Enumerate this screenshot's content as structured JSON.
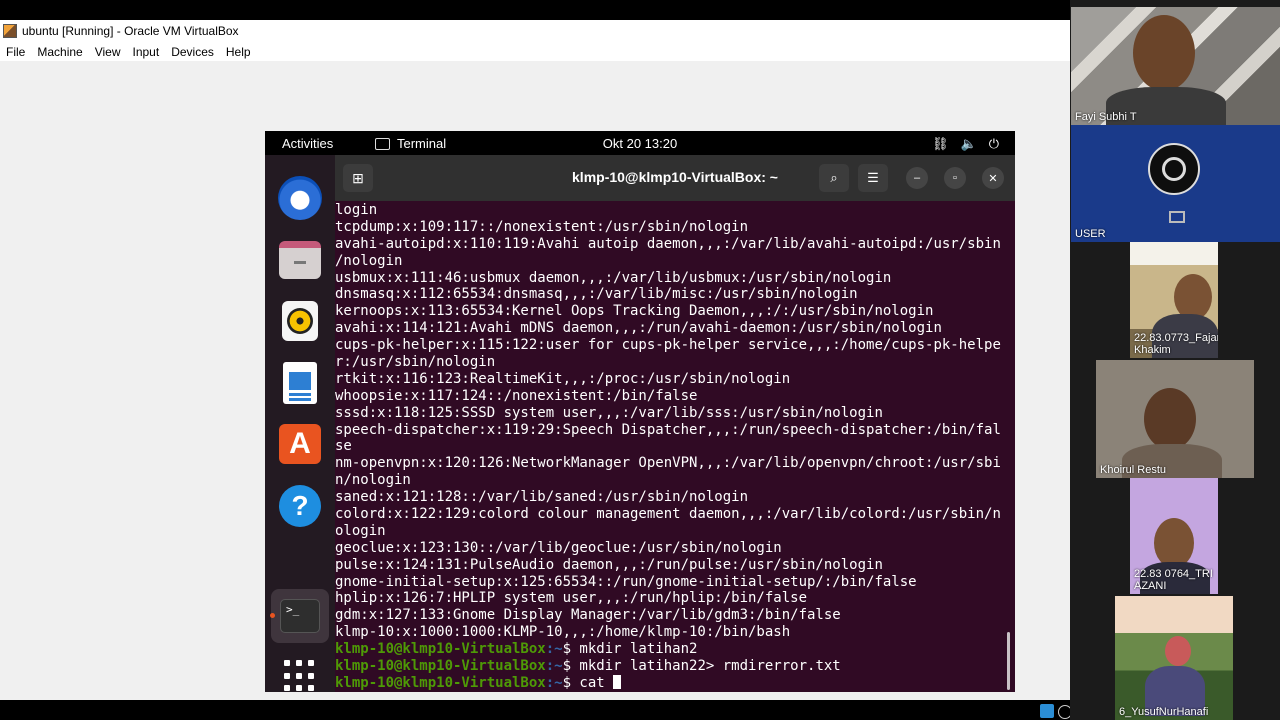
{
  "vbox": {
    "title": "ubuntu [Running] - Oracle VM VirtualBox",
    "menu": [
      "File",
      "Machine",
      "View",
      "Input",
      "Devices",
      "Help"
    ]
  },
  "ubuntu": {
    "activities": "Activities",
    "app_name": "Terminal",
    "clock": "Okt 20  13:20",
    "dock_icons": [
      "thunderbird-icon",
      "files-icon",
      "rhythmbox-icon",
      "libreoffice-writer-icon",
      "app-center-icon",
      "help-icon",
      "terminal-icon",
      "show-apps-icon"
    ]
  },
  "terminal": {
    "title": "klmp-10@klmp10-VirtualBox: ~",
    "prompt_user": "klmp-10@klmp10-VirtualBox",
    "prompt_suffix": ":~",
    "output_lines": [
      "login",
      "tcpdump:x:109:117::/nonexistent:/usr/sbin/nologin",
      "avahi-autoipd:x:110:119:Avahi autoip daemon,,,:/var/lib/avahi-autoipd:/usr/sbin",
      "/nologin",
      "usbmux:x:111:46:usbmux daemon,,,:/var/lib/usbmux:/usr/sbin/nologin",
      "dnsmasq:x:112:65534:dnsmasq,,,:/var/lib/misc:/usr/sbin/nologin",
      "kernoops:x:113:65534:Kernel Oops Tracking Daemon,,,:/:/usr/sbin/nologin",
      "avahi:x:114:121:Avahi mDNS daemon,,,:/run/avahi-daemon:/usr/sbin/nologin",
      "cups-pk-helper:x:115:122:user for cups-pk-helper service,,,:/home/cups-pk-helpe",
      "r:/usr/sbin/nologin",
      "rtkit:x:116:123:RealtimeKit,,,:/proc:/usr/sbin/nologin",
      "whoopsie:x:117:124::/nonexistent:/bin/false",
      "sssd:x:118:125:SSSD system user,,,:/var/lib/sss:/usr/sbin/nologin",
      "speech-dispatcher:x:119:29:Speech Dispatcher,,,:/run/speech-dispatcher:/bin/fal",
      "se",
      "nm-openvpn:x:120:126:NetworkManager OpenVPN,,,:/var/lib/openvpn/chroot:/usr/sbi",
      "n/nologin",
      "saned:x:121:128::/var/lib/saned:/usr/sbin/nologin",
      "colord:x:122:129:colord colour management daemon,,,:/var/lib/colord:/usr/sbin/n",
      "ologin",
      "geoclue:x:123:130::/var/lib/geoclue:/usr/sbin/nologin",
      "pulse:x:124:131:PulseAudio daemon,,,:/run/pulse:/usr/sbin/nologin",
      "gnome-initial-setup:x:125:65534::/run/gnome-initial-setup/:/bin/false",
      "hplip:x:126:7:HPLIP system user,,,:/run/hplip:/bin/false",
      "gdm:x:127:133:Gnome Display Manager:/var/lib/gdm3:/bin/false",
      "klmp-10:x:1000:1000:KLMP-10,,,:/home/klmp-10:/bin/bash"
    ],
    "commands": [
      "$ mkdir latihan2",
      "$ mkdir latihan22> rmdirerror.txt",
      "$ cat "
    ]
  },
  "participants": [
    {
      "name": "Fayi Subhi T"
    },
    {
      "name": "USER"
    },
    {
      "name": "22.83.0773_Fajar Khakim"
    },
    {
      "name": "Khoirul Restu"
    },
    {
      "name": "22.83 0764_TRI AZANI"
    },
    {
      "name": "6_YusufNurHanafi"
    }
  ]
}
